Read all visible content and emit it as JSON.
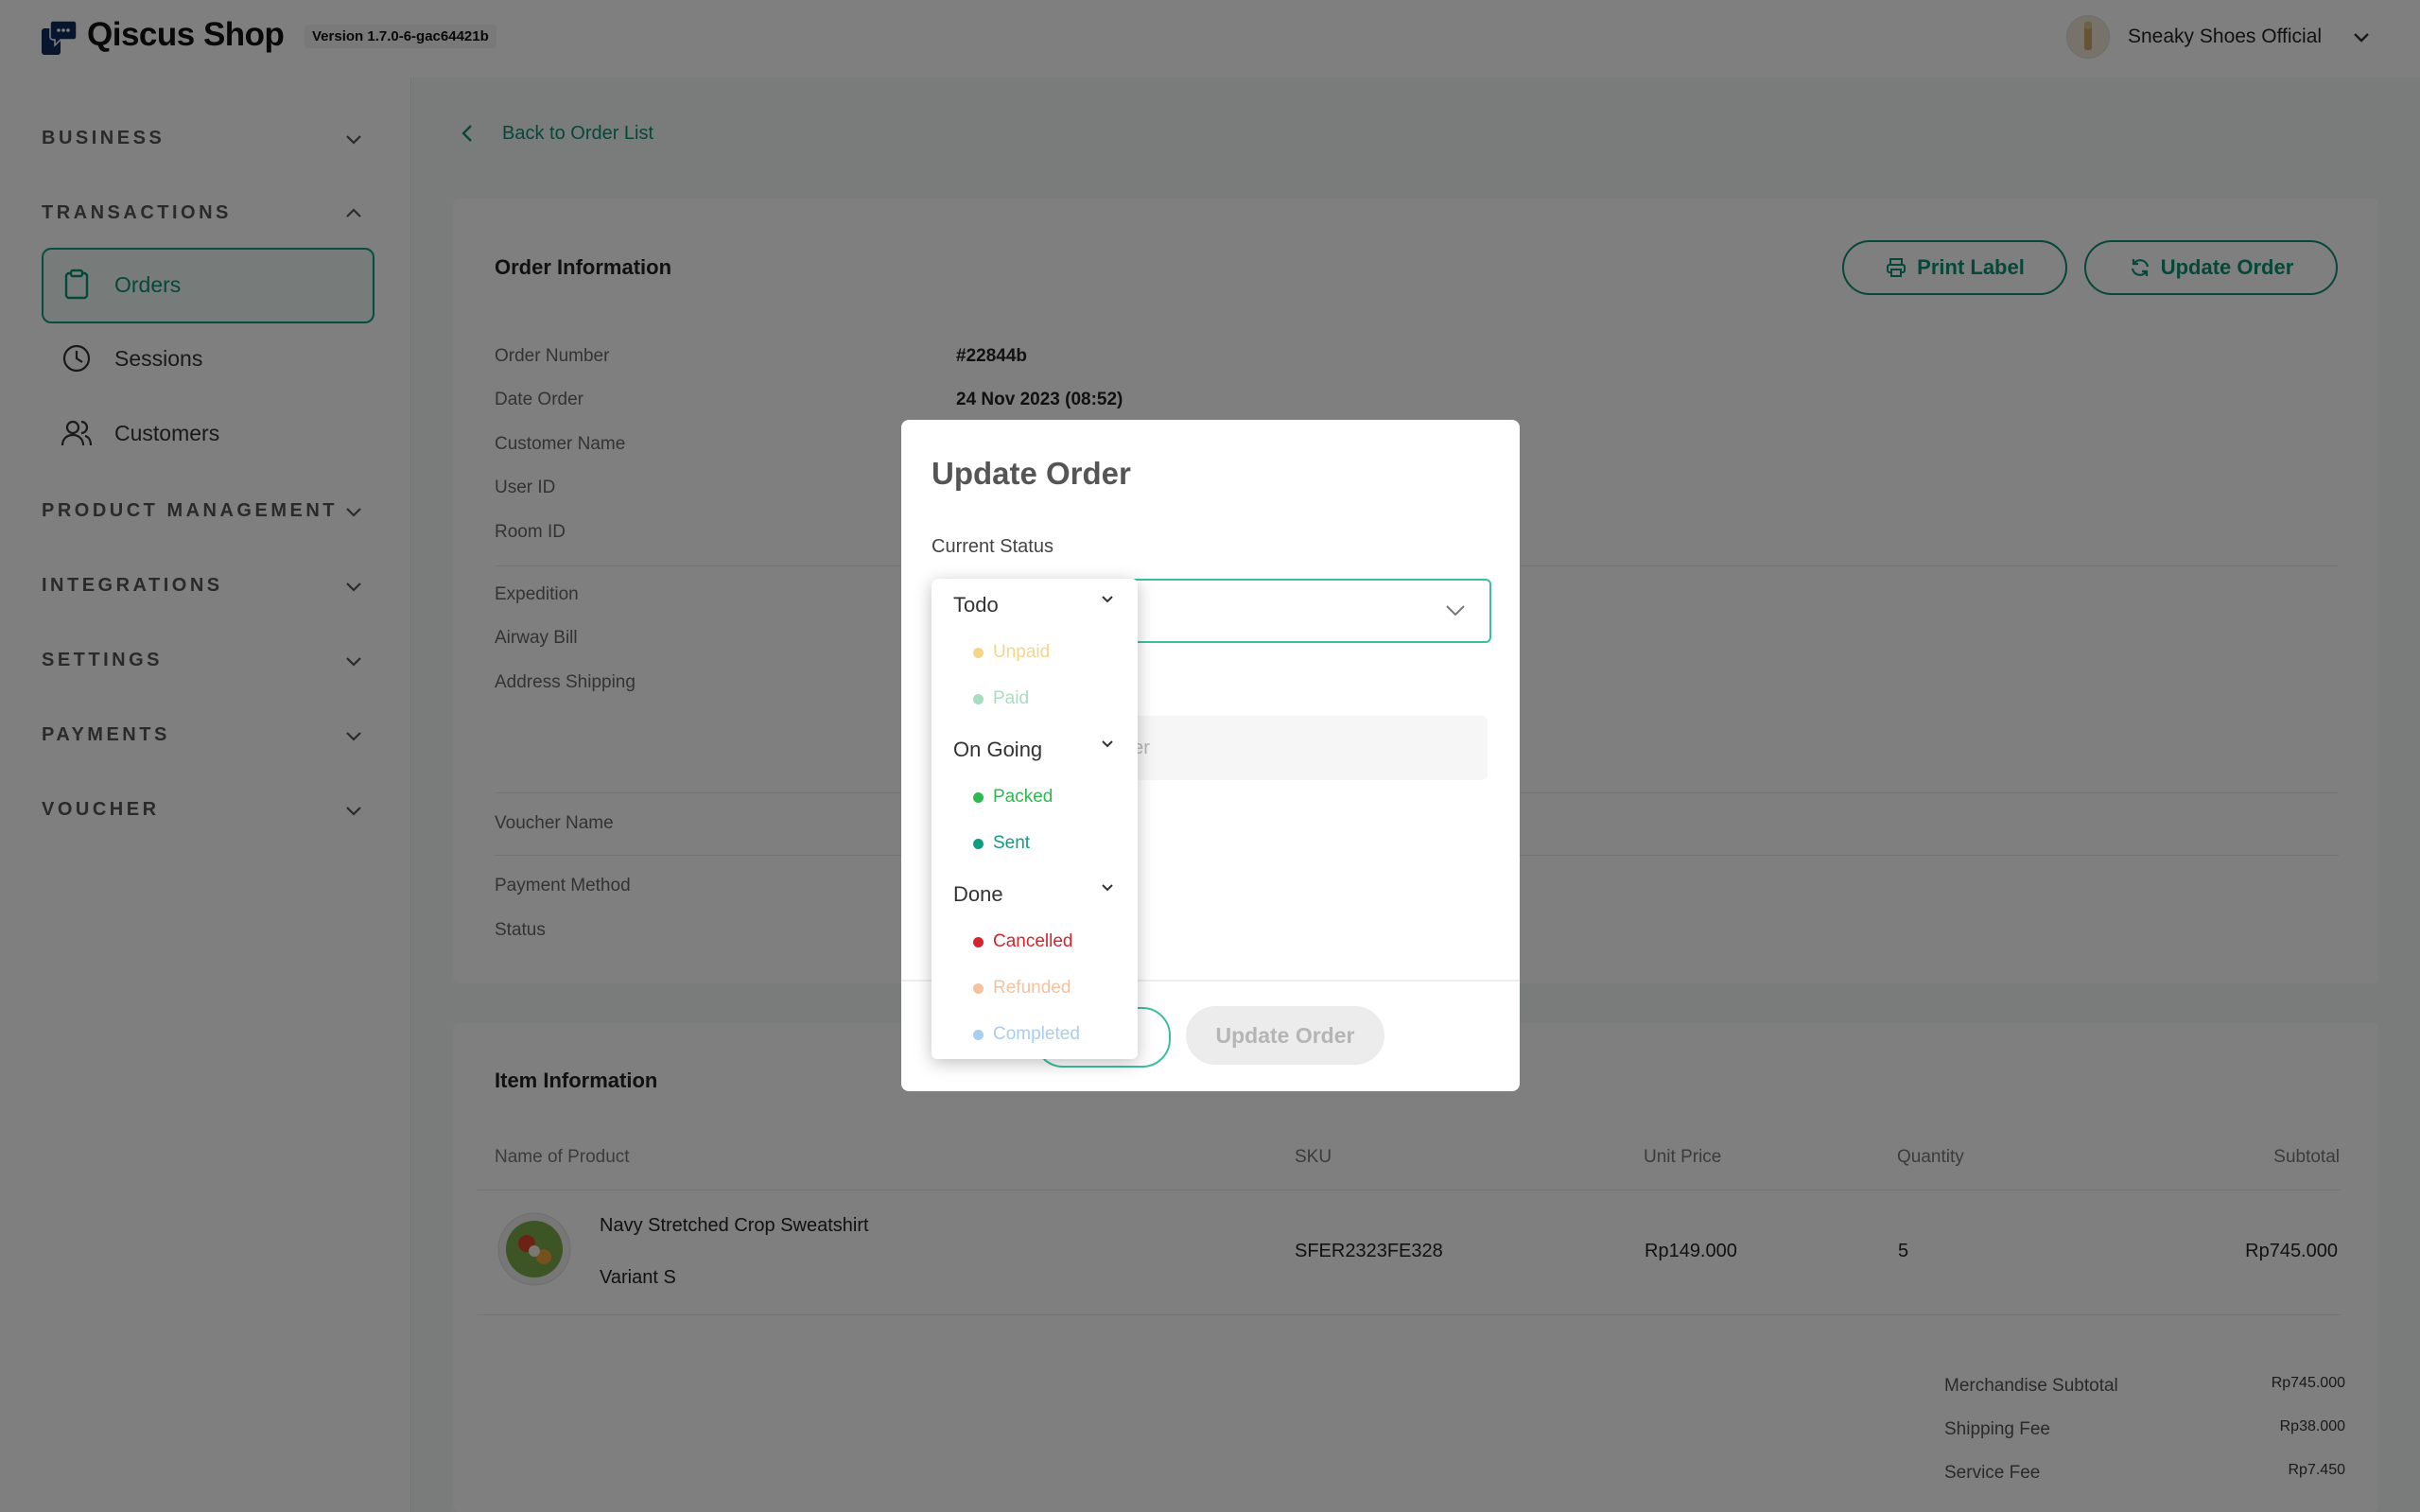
{
  "header": {
    "app_name": "Qiscus Shop",
    "version": "Version 1.7.0-6-gac64421b",
    "store_name": "Sneaky Shoes Official"
  },
  "sidebar": {
    "sections": {
      "business": "BUSINESS",
      "transactions": "TRANSACTIONS",
      "product_management": "PRODUCT MANAGEMENT",
      "integrations": "INTEGRATIONS",
      "settings": "SETTINGS",
      "payments": "PAYMENTS",
      "voucher": "VOUCHER"
    },
    "items": {
      "orders": "Orders",
      "sessions": "Sessions",
      "customers": "Customers"
    }
  },
  "main": {
    "back_link": "Back to Order List",
    "order_info": {
      "title": "Order Information",
      "print_label": "Print Label",
      "update_order": "Update Order",
      "fields": {
        "order_number_label": "Order Number",
        "order_number": "#22844b",
        "date_order_label": "Date Order",
        "date_order": "24 Nov 2023 (08:52)",
        "customer_name_label": "Customer Name",
        "user_id_label": "User ID",
        "room_id_label": "Room ID",
        "expedition_label": "Expedition",
        "airway_bill_label": "Airway Bill",
        "address_shipping_label": "Address Shipping",
        "voucher_name_label": "Voucher Name",
        "payment_method_label": "Payment Method",
        "status_label": "Status"
      }
    },
    "item_info": {
      "title": "Item Information",
      "columns": {
        "name": "Name of Product",
        "sku": "SKU",
        "unit_price": "Unit Price",
        "quantity": "Quantity",
        "subtotal": "Subtotal"
      },
      "rows": [
        {
          "name": "Navy Stretched Crop Sweatshirt",
          "variant": "Variant S",
          "sku": "SFER2323FE328",
          "unit_price": "Rp149.000",
          "quantity": "5",
          "subtotal": "Rp745.000"
        }
      ],
      "summary": {
        "merchandise_label": "Merchandise Subtotal",
        "merchandise_value": "Rp745.000",
        "shipping_label": "Shipping Fee",
        "shipping_value": "Rp38.000",
        "service_label": "Service Fee",
        "service_value": "Rp7.450"
      }
    }
  },
  "modal": {
    "title": "Update Order",
    "current_status_label": "Current Status",
    "tracking_placeholder": "ber",
    "update_button": "Update Order",
    "dropdown": {
      "groups": [
        {
          "label": "Todo",
          "options": [
            {
              "label": "Unpaid",
              "color": "#f5d58a"
            },
            {
              "label": "Paid",
              "color": "#a9dcc0"
            }
          ]
        },
        {
          "label": "On Going",
          "options": [
            {
              "label": "Packed",
              "color": "#2fb84f"
            },
            {
              "label": "Sent",
              "color": "#0e9e80"
            }
          ]
        },
        {
          "label": "Done",
          "options": [
            {
              "label": "Cancelled",
              "color": "#d8232a"
            },
            {
              "label": "Refunded",
              "color": "#f4c2a0"
            },
            {
              "label": "Completed",
              "color": "#a9cdee"
            }
          ]
        }
      ]
    }
  },
  "colors": {
    "accent": "#0b8e72",
    "overlay": "rgba(0,0,0,0.5)"
  }
}
